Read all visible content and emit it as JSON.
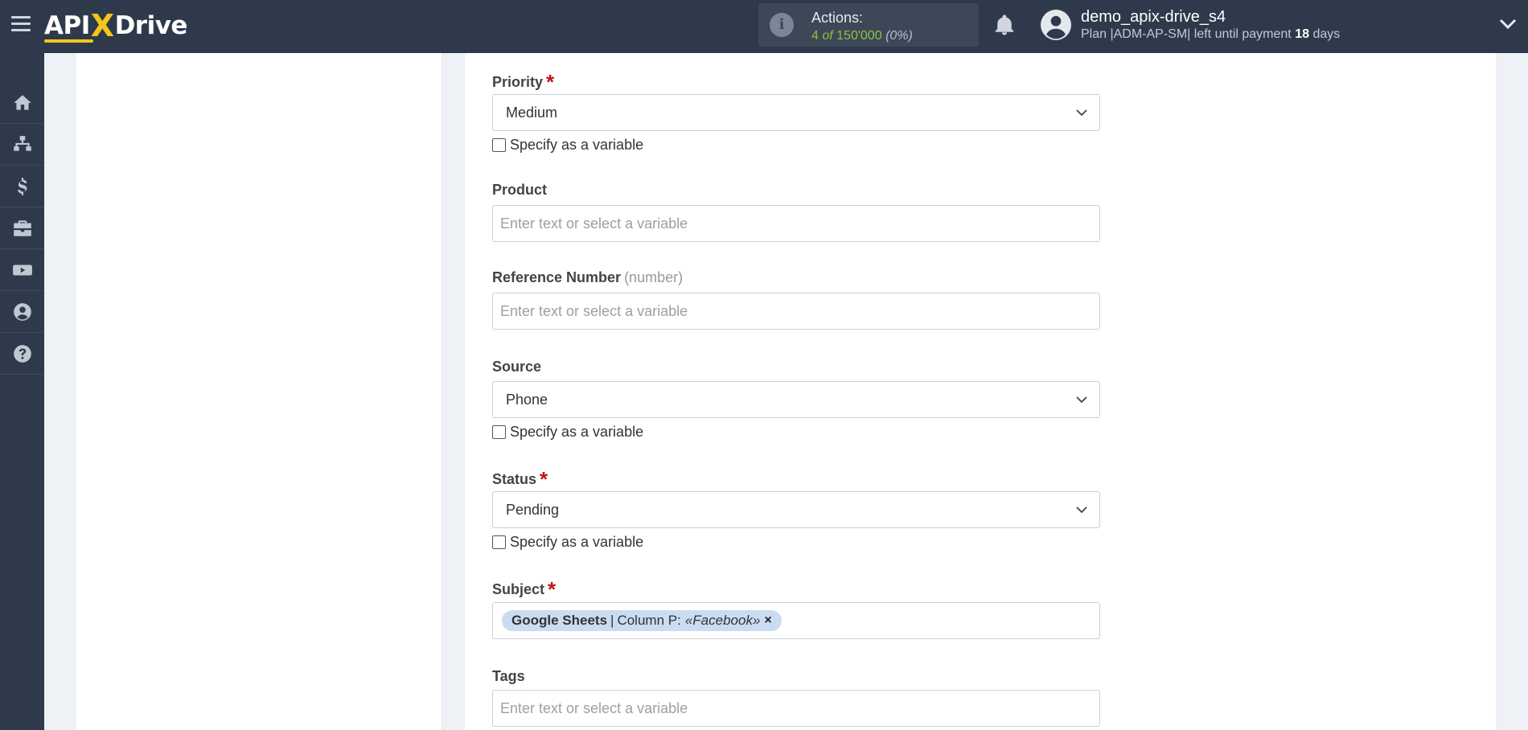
{
  "header": {
    "logo_left": "API",
    "logo_x": "X",
    "logo_right": "Drive",
    "actions_label": "Actions:",
    "actions_used": "4",
    "actions_of": "of",
    "actions_total": "150'000",
    "actions_pct": "(0%)",
    "user_name": "demo_apix-drive_s4",
    "plan_text": "Plan |ADM-AP-SM| left until payment",
    "plan_days": "18",
    "plan_days_unit": "days"
  },
  "sidebar": {
    "items": [
      {
        "icon": "home-icon"
      },
      {
        "icon": "sitemap-icon"
      },
      {
        "icon": "dollar-icon"
      },
      {
        "icon": "briefcase-icon"
      },
      {
        "icon": "youtube-icon"
      },
      {
        "icon": "user-circle-icon"
      },
      {
        "icon": "help-icon"
      }
    ]
  },
  "form": {
    "priority": {
      "label": "Priority",
      "required": "*",
      "value": "Medium",
      "checkbox": "Specify as a variable"
    },
    "product": {
      "label": "Product",
      "placeholder": "Enter text or select a variable"
    },
    "reference": {
      "label": "Reference Number",
      "hint": "(number)",
      "placeholder": "Enter text or select a variable"
    },
    "source": {
      "label": "Source",
      "value": "Phone",
      "checkbox": "Specify as a variable"
    },
    "status": {
      "label": "Status",
      "required": "*",
      "value": "Pending",
      "checkbox": "Specify as a variable"
    },
    "subject": {
      "label": "Subject",
      "required": "*",
      "chip": {
        "source": "Google Sheets",
        "separator": "|",
        "column": "Column P:",
        "value": "«Facebook»",
        "remove": "×"
      }
    },
    "tags": {
      "label": "Tags",
      "placeholder": "Enter text or select a variable"
    }
  }
}
